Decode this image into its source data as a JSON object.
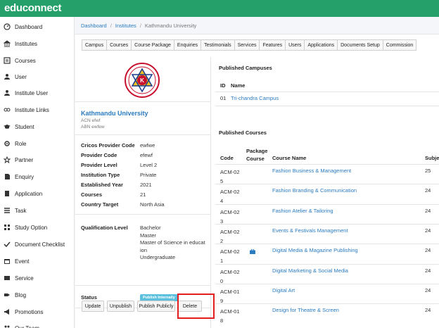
{
  "app": {
    "logo": "educonnect"
  },
  "sidebar": {
    "items": [
      {
        "label": "Dashboard",
        "icon": "dashboard-icon"
      },
      {
        "label": "Institutes",
        "icon": "institute-icon"
      },
      {
        "label": "Courses",
        "icon": "courses-icon"
      },
      {
        "label": "User",
        "icon": "user-icon"
      },
      {
        "label": "Institute User",
        "icon": "institute-user-icon"
      },
      {
        "label": "Institute Links",
        "icon": "links-icon"
      },
      {
        "label": "Student",
        "icon": "student-icon"
      },
      {
        "label": "Role",
        "icon": "role-icon"
      },
      {
        "label": "Partner",
        "icon": "partner-icon"
      },
      {
        "label": "Enquiry",
        "icon": "enquiry-icon"
      },
      {
        "label": "Application",
        "icon": "application-icon"
      },
      {
        "label": "Task",
        "icon": "task-icon"
      },
      {
        "label": "Study Option",
        "icon": "study-option-icon"
      },
      {
        "label": "Document Checklist",
        "icon": "document-checklist-icon"
      },
      {
        "label": "Event",
        "icon": "event-icon"
      },
      {
        "label": "Service",
        "icon": "service-icon"
      },
      {
        "label": "Blog",
        "icon": "blog-icon"
      },
      {
        "label": "Promotions",
        "icon": "promotions-icon"
      },
      {
        "label": "Our Team",
        "icon": "team-icon"
      }
    ]
  },
  "breadcrumb": {
    "dashboard": "Dashboard",
    "institutes": "Institutes",
    "current": "Kathmandu University"
  },
  "tabs": [
    "Campus",
    "Courses",
    "Course Package",
    "Enquiries",
    "Testimonials",
    "Services",
    "Features",
    "Users",
    "Applications",
    "Documents Setup",
    "Commission"
  ],
  "institute": {
    "name": "Kathmandu University",
    "acn": "ACN efwf",
    "abn": "ABN ewfew",
    "details": [
      {
        "label": "Cricos Provider Code",
        "value": "ewfwe"
      },
      {
        "label": "Provider Code",
        "value": "efewf"
      },
      {
        "label": "Provider Level",
        "value": "Level 2"
      },
      {
        "label": "Institution Type",
        "value": "Private"
      },
      {
        "label": "Established Year",
        "value": "2021"
      },
      {
        "label": "Courses",
        "value": "21"
      },
      {
        "label": "Country Target",
        "value": "North Asia"
      }
    ],
    "qualification_label": "Qualification Level",
    "qualification_lines": [
      "Bachelor",
      "Master",
      "Master of Science in educat",
      "ion",
      "Undergraduate"
    ],
    "status_label": "Status",
    "status_badge": "Publish Internally"
  },
  "actions": {
    "update": "Update",
    "unpublish": "Unpublish",
    "publish_publicly": "Publish Publicly",
    "delete": "Delete"
  },
  "published_campuses": {
    "title": "Published Campuses",
    "headers": {
      "id": "ID",
      "name": "Name"
    },
    "rows": [
      {
        "id": "01",
        "name": "Tri-chandra Campus"
      }
    ]
  },
  "published_courses": {
    "title": "Published Courses",
    "headers": {
      "code": "Code",
      "package": "Package Course",
      "name": "Course Name",
      "subject": "Subje"
    },
    "rows": [
      {
        "code": "ACM-025",
        "name": "Fashion Business & Management",
        "subjects": "25",
        "package": false
      },
      {
        "code": "ACM-024",
        "name": "Fashion Branding & Communication",
        "subjects": "24",
        "package": false
      },
      {
        "code": "ACM-023",
        "name": "Fashion Atelier & Tailoring",
        "subjects": "24",
        "package": false
      },
      {
        "code": "ACM-022",
        "name": "Events & Festivals Management",
        "subjects": "24",
        "package": false
      },
      {
        "code": "ACM-021",
        "name": "Digital Media & Magazine Publishing",
        "subjects": "24",
        "package": true
      },
      {
        "code": "ACM-020",
        "name": "Digital Marketing & Social Media",
        "subjects": "24",
        "package": false
      },
      {
        "code": "ACM-019",
        "name": "Digital Art",
        "subjects": "24",
        "package": false
      },
      {
        "code": "ACM-018",
        "name": "Design for Theatre & Screen",
        "subjects": "24",
        "package": false
      }
    ]
  },
  "colors": {
    "brand": "#25a06a",
    "link": "#2b7bbf",
    "badge": "#5bc0de",
    "highlight": "#e41e1e"
  }
}
